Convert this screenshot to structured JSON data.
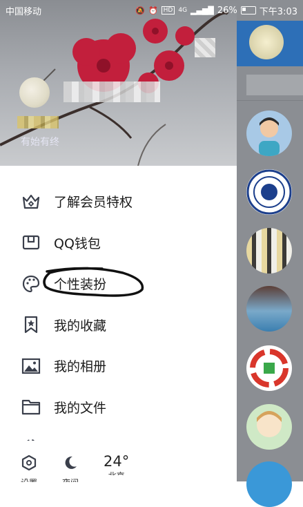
{
  "status_bar": {
    "carrier": "中国移动",
    "hd_badge": "HD",
    "network": "4G",
    "battery": "26%",
    "time": "下午3:03"
  },
  "profile": {
    "signature": "有始有终"
  },
  "menu": [
    {
      "label": "了解会员特权",
      "icon": "crown-icon"
    },
    {
      "label": "QQ钱包",
      "icon": "wallet-icon"
    },
    {
      "label": "个性装扮",
      "icon": "palette-icon"
    },
    {
      "label": "我的收藏",
      "icon": "bookmark-star-icon"
    },
    {
      "label": "我的相册",
      "icon": "photo-album-icon"
    },
    {
      "label": "我的文件",
      "icon": "folder-icon"
    }
  ],
  "bottom_bar": {
    "settings_label": "设置",
    "night_label": "夜间",
    "temperature": "24°",
    "city_label": "北京"
  },
  "colors": {
    "accent_blue": "#2d6fb7",
    "menu_icon": "#3a3f4b"
  }
}
